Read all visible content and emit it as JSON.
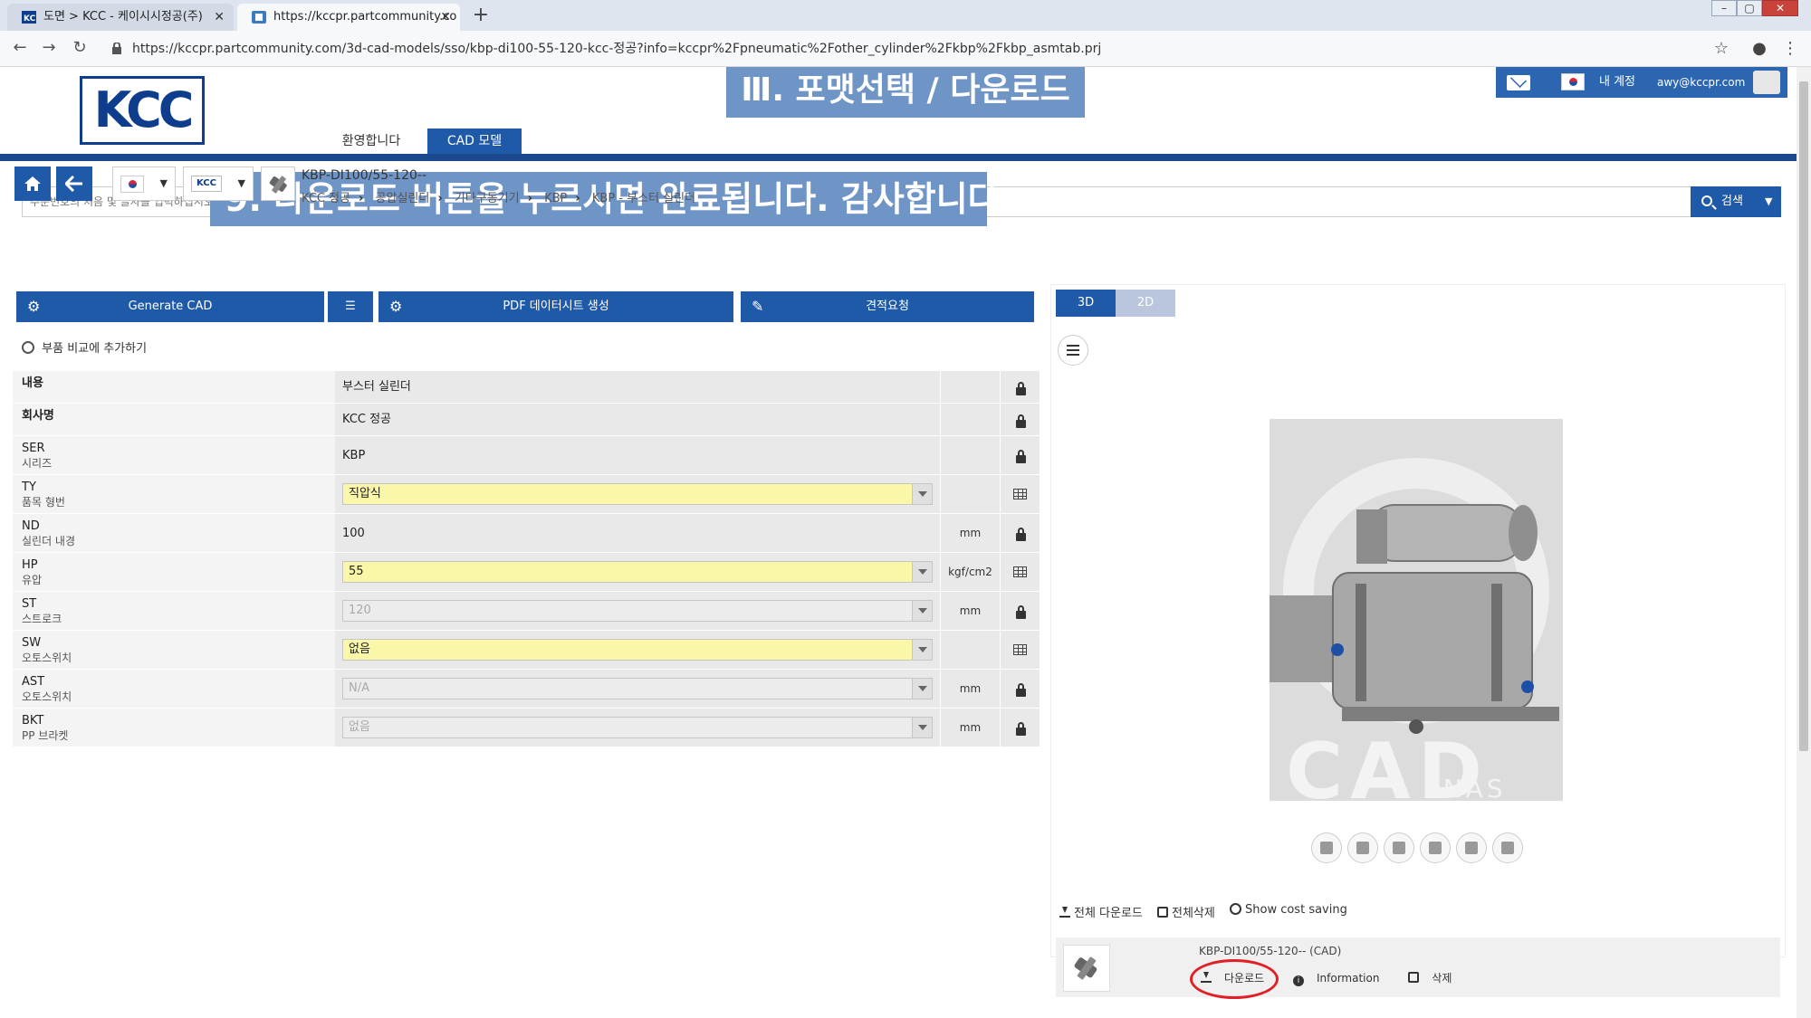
{
  "browser": {
    "tabs": [
      {
        "label": "도면 > KCC - 케이시시정공(주)",
        "active": false
      },
      {
        "label": "https://kccpr.partcommunity.co",
        "active": true
      }
    ],
    "new_tab_label": "+",
    "url": "https://kccpr.partcommunity.com/3d-cad-models/sso/kbp-di100-55-120-kcc-정공?info=kccpr%2Fpneumatic%2Fother_cylinder%2Fkbp%2Fkbp_asmtab.prj"
  },
  "header": {
    "logo_text": "KCC",
    "nav_tabs": [
      "환영합니다",
      "CAD 모델"
    ],
    "account_label": "내 계정",
    "account_email": "awy@kccpr.com"
  },
  "overlays": {
    "title": "Ⅲ. 포맷선택 / 다운로드",
    "step": "9. 다운로드 버튼을 누르시면 완료됩니다. 감사합니다."
  },
  "search": {
    "placeholder": "주문번호의 처음 몇 글자를 입력하십시오",
    "button_label": "검색"
  },
  "part": {
    "id": "KBP-DI100/55-120--",
    "breadcrumb": [
      "KCC 정공",
      "공압실린더",
      "기타구동기기",
      "KBP",
      "KBP - 부스터 실린더"
    ]
  },
  "actions": {
    "generate_cad": "Generate CAD",
    "pdf_datasheet": "PDF 데이터시트 생성",
    "quote_request": "견적요청",
    "add_compare": "부품 비교에 추가하기"
  },
  "params": [
    {
      "code": "내용",
      "desc": "",
      "value": "부스터 실린더",
      "unit": "",
      "kind": "text",
      "icon": "lock-icon",
      "bold": true
    },
    {
      "code": "회사명",
      "desc": "",
      "value": "KCC 정공",
      "unit": "",
      "kind": "text",
      "icon": "lock-icon",
      "bold": true
    },
    {
      "code": "SER",
      "desc": "시리즈",
      "value": "KBP",
      "unit": "",
      "kind": "text",
      "icon": "lock-icon",
      "bold": false
    },
    {
      "code": "TY",
      "desc": "품목 형번",
      "value": "직압식",
      "unit": "",
      "kind": "select-yellow",
      "icon": "table-icon",
      "bold": false
    },
    {
      "code": "ND",
      "desc": "실린더 내경",
      "value": "100",
      "unit": "mm",
      "kind": "text",
      "icon": "lock-icon",
      "bold": false
    },
    {
      "code": "HP",
      "desc": "유압",
      "value": "55",
      "unit": "kgf/cm2",
      "kind": "select-yellow",
      "icon": "table-icon",
      "bold": false
    },
    {
      "code": "ST",
      "desc": "스트로크",
      "value": "120",
      "unit": "mm",
      "kind": "select-disabled",
      "icon": "lock-icon",
      "bold": false
    },
    {
      "code": "SW",
      "desc": "오토스위치",
      "value": "없음",
      "unit": "",
      "kind": "select-yellow",
      "icon": "table-icon",
      "bold": false
    },
    {
      "code": "AST",
      "desc": "오토스위치",
      "value": "N/A",
      "unit": "mm",
      "kind": "select-disabled",
      "icon": "lock-icon",
      "bold": false
    },
    {
      "code": "BKT",
      "desc": "PP 브라켓",
      "value": "없음",
      "unit": "mm",
      "kind": "select-disabled",
      "icon": "lock-icon",
      "bold": false
    }
  ],
  "viewer": {
    "tab_3d": "3D",
    "tab_2d": "2D",
    "watermark": "CAD",
    "watermark_sub": "ENAS"
  },
  "downloads": {
    "download_all": "전체 다운로드",
    "delete_all": "전체삭제",
    "show_cost_saving": "Show cost saving",
    "item_name": "KBP-DI100/55-120-- (CAD)",
    "download_label": "다운로드",
    "information_label": "Information",
    "delete_label": "삭제"
  },
  "colors": {
    "primary_blue": "#1f5aa8",
    "rule_blue": "#1b4990",
    "overlay_blue": "#6f94c6",
    "highlight_yellow": "#fbf7a9",
    "callout_red": "#e01f26"
  }
}
